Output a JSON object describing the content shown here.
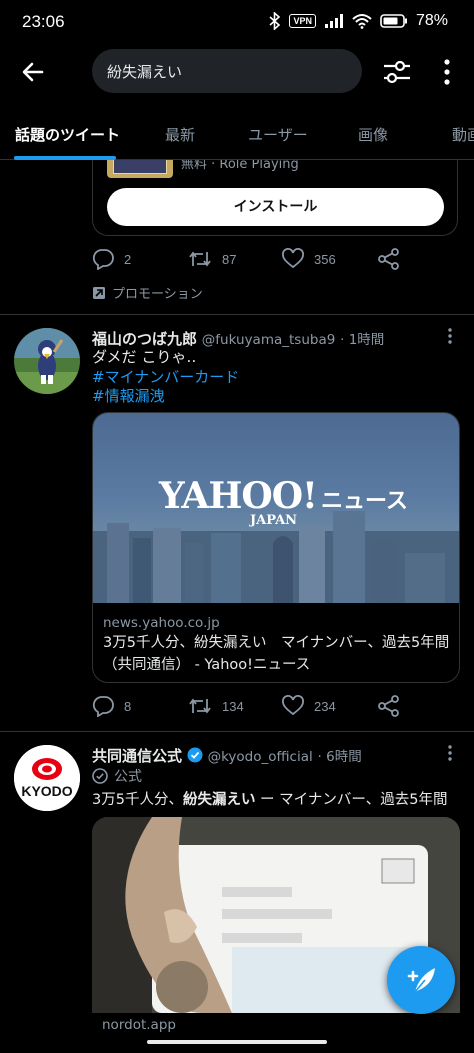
{
  "status_bar": {
    "time": "23:06",
    "vpn": "VPN",
    "battery": "78"
  },
  "search": {
    "query": "紛失漏えい"
  },
  "tabs": [
    {
      "label": "話題のツイート",
      "active": true
    },
    {
      "label": "最新"
    },
    {
      "label": "ユーザー"
    },
    {
      "label": "画像"
    },
    {
      "label": "動画"
    }
  ],
  "promo": {
    "subtitle": "無料 · Role Playing",
    "install_label": "インストール",
    "replies": "2",
    "retweets": "87",
    "likes": "356",
    "promotion_label": "プロモーション"
  },
  "tweet1": {
    "name": "福山のつば九郎",
    "handle": "@fukuyama_tsuba9",
    "time": "· 1時間",
    "text_line1": "ダメだ こりゃ‥",
    "hashtag1": "#マイナンバーカード",
    "hashtag2": "#情報漏洩",
    "card_logo": "YAHOO!",
    "card_logo_sub": "JAPAN",
    "card_logo_news": "ニュース",
    "card_domain": "news.yahoo.co.jp",
    "card_title": "3万5千人分、紛失漏えい　マイナンバー、過去5年間（共同通信） - Yahoo!ニュース",
    "replies": "8",
    "retweets": "134",
    "likes": "234"
  },
  "tweet2": {
    "name": "共同通信公式",
    "handle": "@kyodo_official",
    "time": "· 6時間",
    "verified_label": "公式",
    "text_prefix": "3万5千人分、",
    "text_bold": "紛失漏えい",
    "text_suffix": " ー マイナンバー、過去5年間",
    "avatar_text": "KYODO",
    "card_domain": "nordot.app"
  },
  "colors": {
    "accent": "#1d9bf0",
    "background": "#000000",
    "muted": "#8b98a5"
  }
}
